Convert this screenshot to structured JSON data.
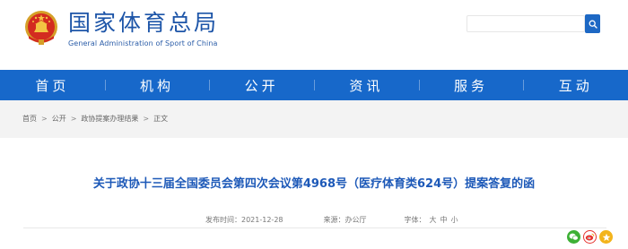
{
  "header": {
    "title": "国家体育总局",
    "subtitle": "General Administration of Sport of China",
    "search_placeholder": ""
  },
  "nav": {
    "items": [
      "首页",
      "机构",
      "公开",
      "资讯",
      "服务",
      "互动"
    ]
  },
  "breadcrumb": {
    "items": [
      "首页",
      "公开",
      "政协提案办理结果",
      "正文"
    ],
    "separator": ">"
  },
  "article": {
    "title": "关于政协十三届全国委员会第四次会议第4968号（医疗体育类624号）提案答复的函",
    "date_label": "发布时间：",
    "date": "2021-12-28",
    "source_label": "来源：",
    "source": "办公厅",
    "font_label": "字体：",
    "font_sizes": [
      "大",
      "中",
      "小"
    ]
  },
  "share": {
    "icons": [
      "wechat-icon",
      "weibo-icon",
      "qzone-icon"
    ]
  },
  "colors": {
    "brand_blue": "#1768ca",
    "title_blue": "#1d59b8",
    "wechat": "#3db035",
    "weibo": "#e5342f",
    "qzone": "#f3b41b"
  }
}
